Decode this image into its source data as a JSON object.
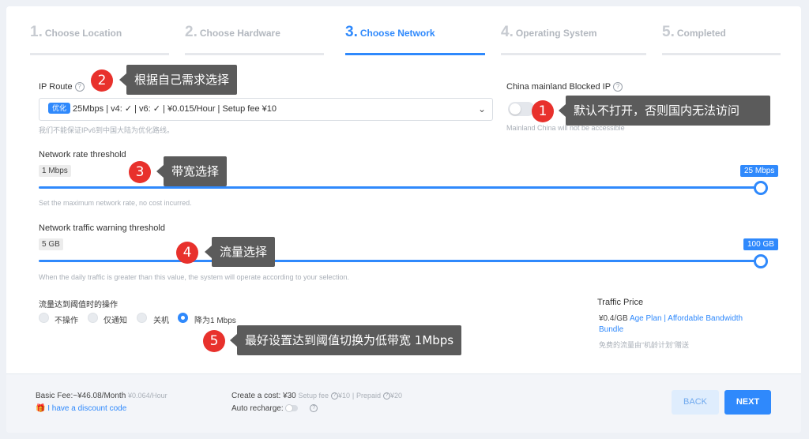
{
  "steps": [
    {
      "num": "1.",
      "label": "Choose Location"
    },
    {
      "num": "2.",
      "label": "Choose Hardware"
    },
    {
      "num": "3.",
      "label": "Choose Network"
    },
    {
      "num": "4.",
      "label": "Operating System"
    },
    {
      "num": "5.",
      "label": "Completed"
    }
  ],
  "active_step": 3,
  "ip_route": {
    "label": "IP Route",
    "badge": "优化",
    "value": "25Mbps | v4: ✓ | v6: ✓ | ¥0.015/Hour | Setup fee ¥10",
    "hint": "我们不能保证IPv6到中国大陆为优化路线。"
  },
  "china_blocked": {
    "label": "China mainland Blocked IP",
    "hint": "Mainland China will not be accessible",
    "enabled": false
  },
  "rate": {
    "label": "Network rate threshold",
    "min": "1 Mbps",
    "max": "25 Mbps",
    "value_fraction": 1.0,
    "hint": "Set the maximum network rate, no cost incurred."
  },
  "traffic": {
    "label": "Network traffic warning threshold",
    "min": "5 GB",
    "max": "100 GB",
    "value_fraction": 1.0,
    "hint": "When the daily traffic is greater than this value, the system will operate according to your selection."
  },
  "action": {
    "label": "流量达到阈值时的操作",
    "options": [
      "不操作",
      "仅通知",
      "关机",
      "降为1 Mbps"
    ],
    "selected_index": 3
  },
  "traffic_price": {
    "title": "Traffic Price",
    "price": "¥0.4/GB",
    "link1": "Age Plan",
    "sep": "|",
    "link2_line1": "Affordable Bandwidth",
    "link2_line2": "Bundle",
    "note": "免费的流量由“机龄计划”赠送"
  },
  "annotations": [
    {
      "num": "1",
      "text": "默认不打开，否则国内无法访问"
    },
    {
      "num": "2",
      "text": "根据自己需求选择"
    },
    {
      "num": "3",
      "text": "带宽选择"
    },
    {
      "num": "4",
      "text": "流量选择"
    },
    {
      "num": "5",
      "text": "最好设置达到阈值切换为低带宽 1Mbps"
    }
  ],
  "footer": {
    "basic_fee_label": "Basic Fee:~",
    "basic_fee_value": "¥46.08/Month",
    "basic_fee_hourly": "¥0.064/Hour",
    "discount": "I have a discount code",
    "create_cost_label": "Create a cost:",
    "create_cost_value": "¥30",
    "setup_fee": "Setup fee",
    "setup_fee_value": "¥10",
    "prepaid": "Prepaid",
    "prepaid_value": "¥20",
    "auto_recharge": "Auto recharge:",
    "back": "BACK",
    "next": "NEXT"
  },
  "colors": {
    "accent": "#2f89fc",
    "annotation_red": "#e8312c",
    "annotation_box": "#5b5b5b"
  }
}
